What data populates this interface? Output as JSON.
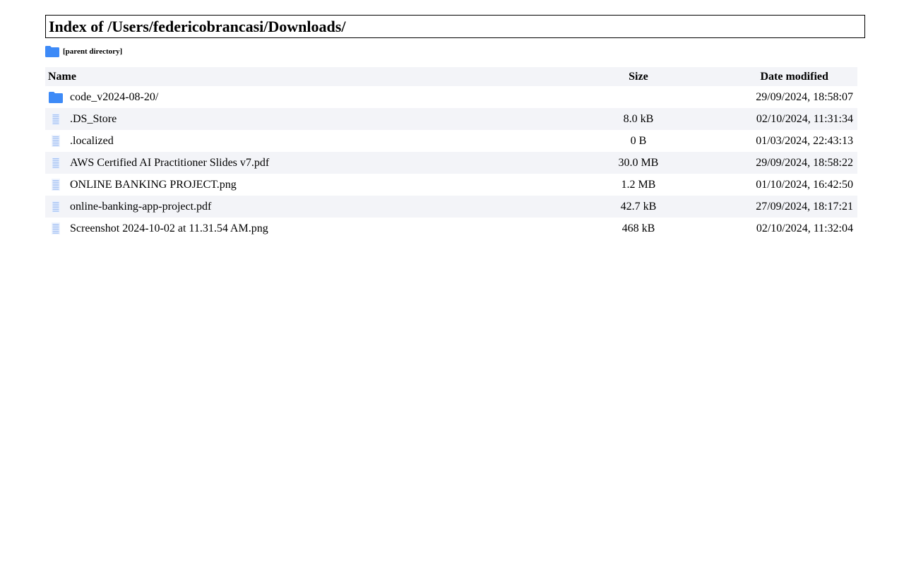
{
  "header": {
    "title": "Index of /Users/federicobrancasi/Downloads/"
  },
  "parent": {
    "label": "[parent directory]",
    "icon": "folder-icon"
  },
  "table": {
    "columns": {
      "name": "Name",
      "size": "Size",
      "date": "Date modified"
    },
    "rows": [
      {
        "name": "code_v2024-08-20/",
        "size": "",
        "date": "29/09/2024, 18:58:07",
        "icon": "folder-icon"
      },
      {
        "name": ".DS_Store",
        "size": "8.0 kB",
        "date": "02/10/2024, 11:31:34",
        "icon": "file-icon"
      },
      {
        "name": ".localized",
        "size": "0 B",
        "date": "01/03/2024, 22:43:13",
        "icon": "file-icon"
      },
      {
        "name": "AWS Certified AI Practitioner Slides v7.pdf",
        "size": "30.0 MB",
        "date": "29/09/2024, 18:58:22",
        "icon": "file-icon"
      },
      {
        "name": "ONLINE BANKING PROJECT.png",
        "size": "1.2 MB",
        "date": "01/10/2024, 16:42:50",
        "icon": "file-icon"
      },
      {
        "name": "online-banking-app-project.pdf",
        "size": "42.7 kB",
        "date": "27/09/2024, 18:17:21",
        "icon": "file-icon"
      },
      {
        "name": "Screenshot 2024-10-02 at 11.31.54 AM.png",
        "size": "468 kB",
        "date": "02/10/2024, 11:32:04",
        "icon": "file-icon"
      }
    ]
  },
  "colors": {
    "folder": "#3d8af7",
    "file": "#a4c2f4",
    "row_stripe": "#f3f4f8"
  }
}
